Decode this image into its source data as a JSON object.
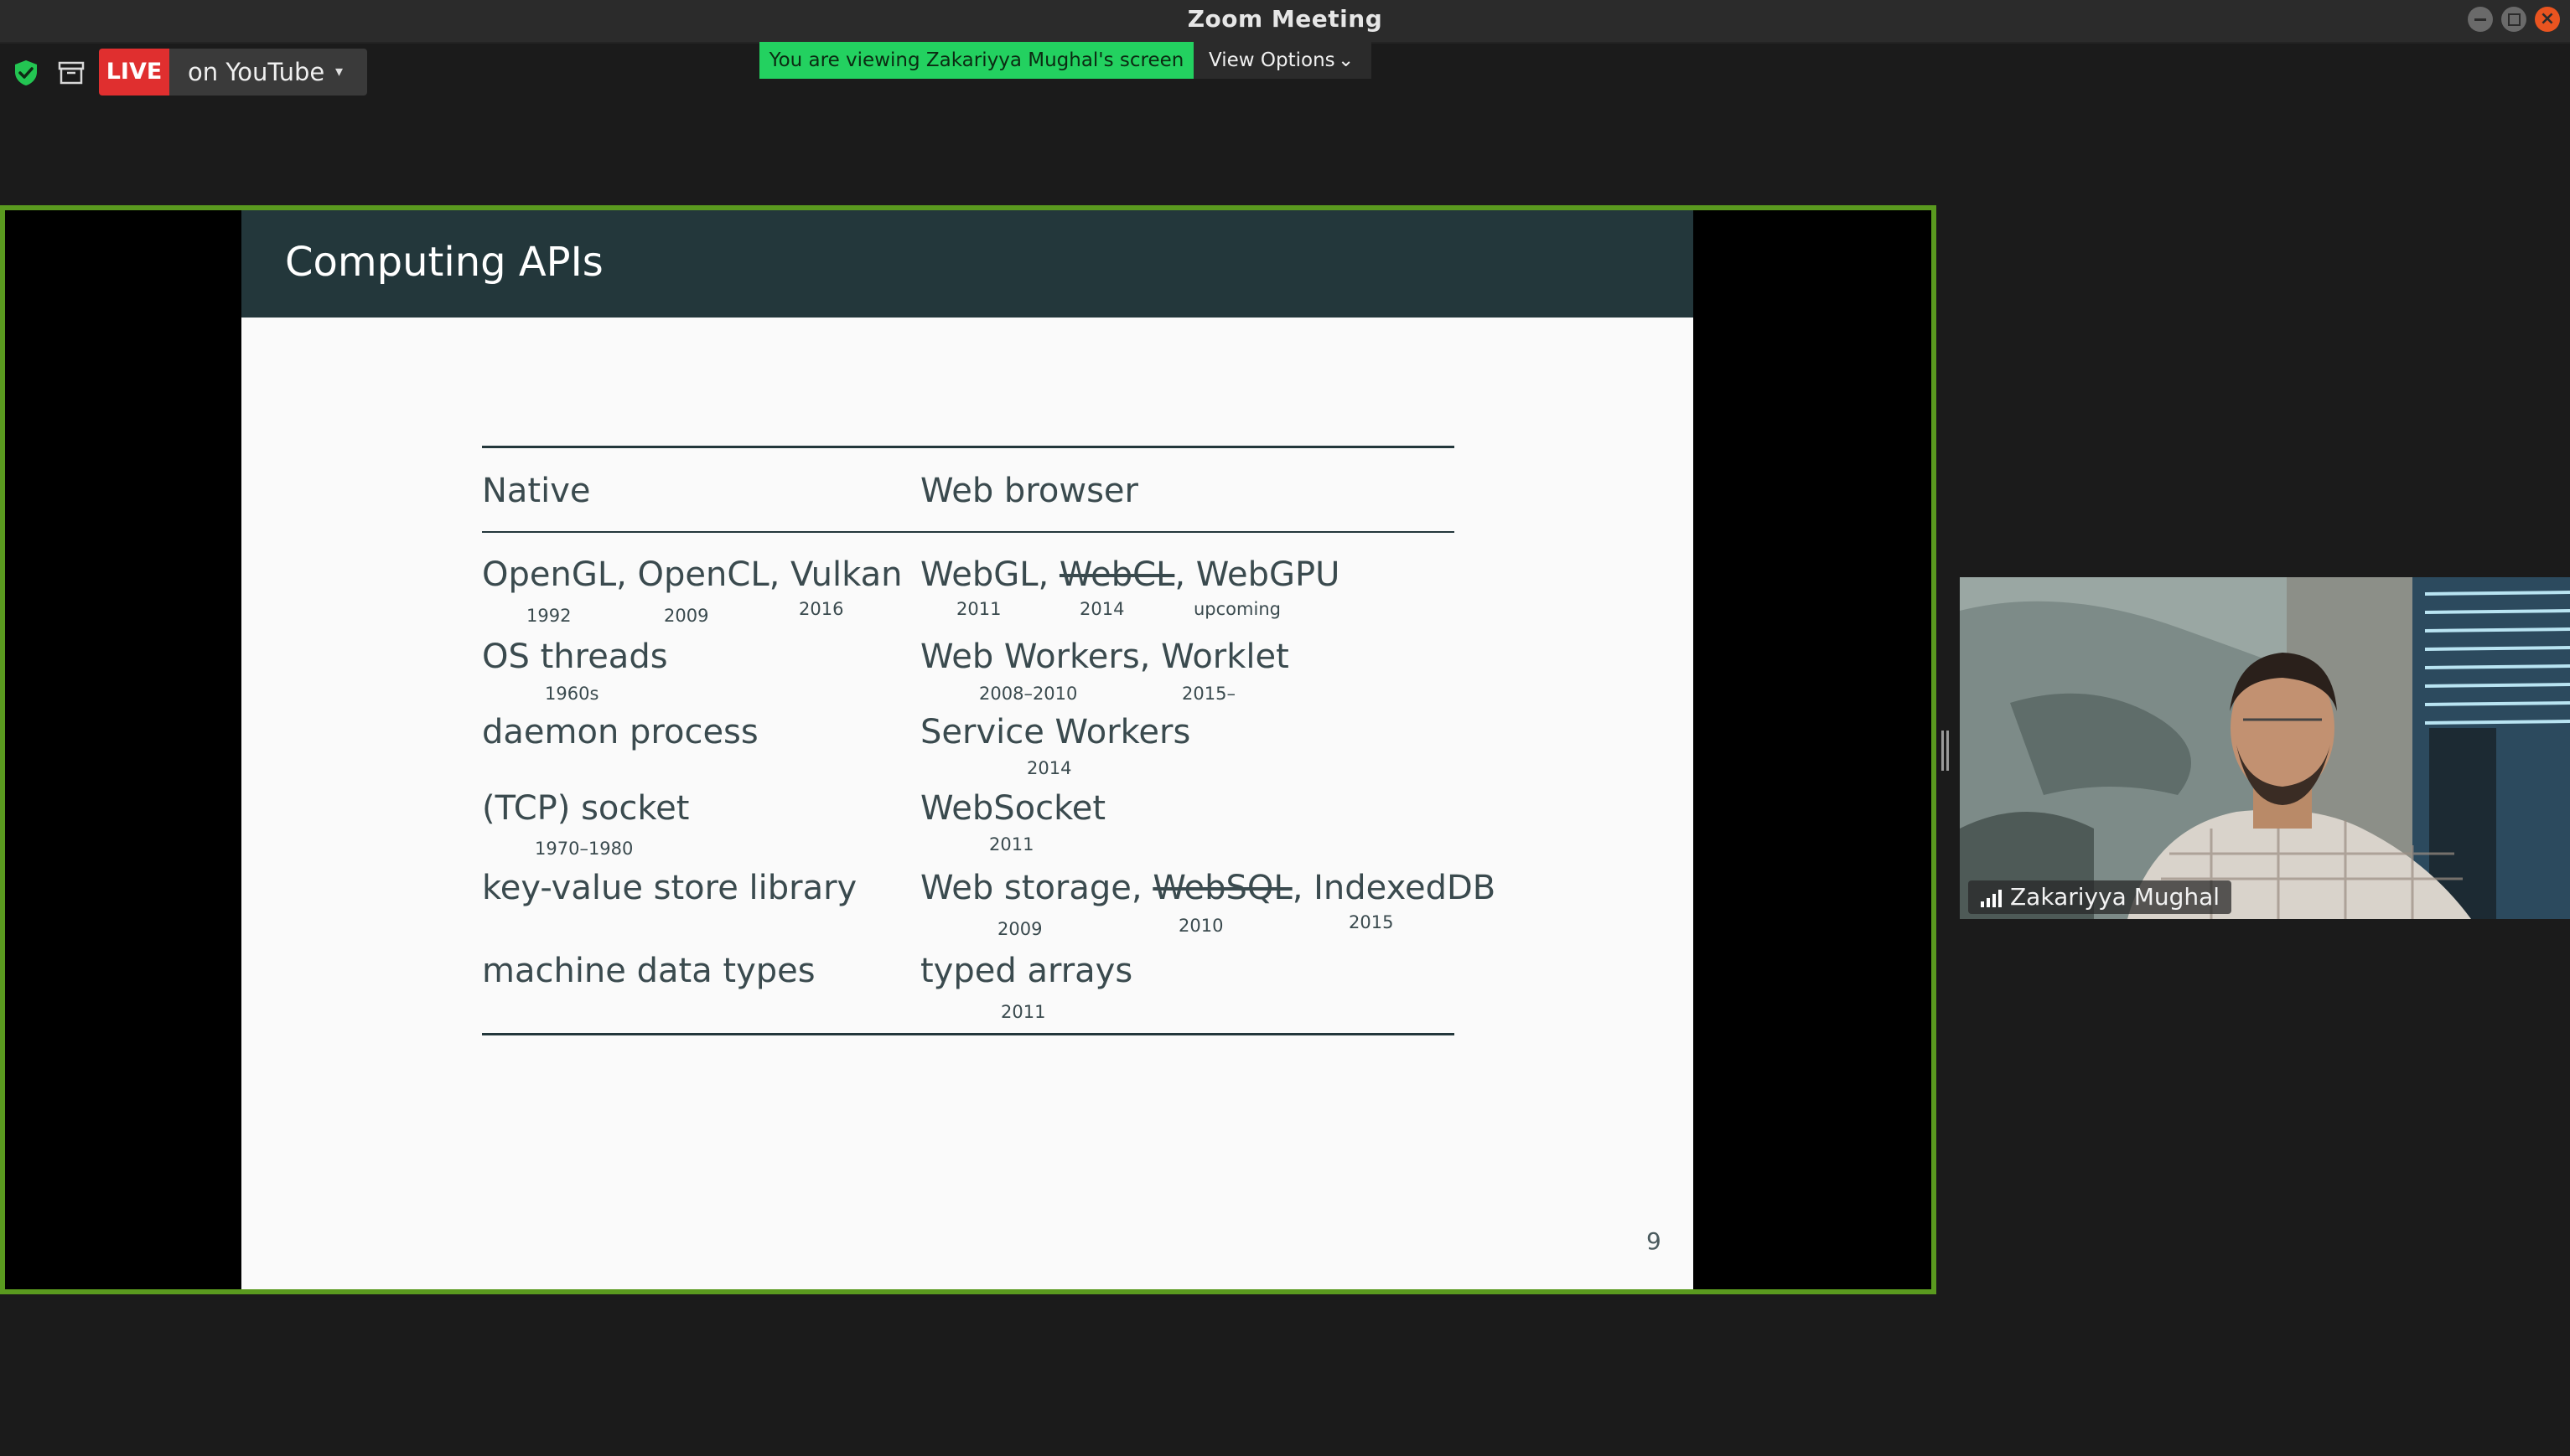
{
  "window": {
    "title": "Zoom Meeting",
    "controls": {
      "minimize": "minimize-icon",
      "maximize": "maximize-icon",
      "close": "close-icon"
    }
  },
  "toolbar": {
    "security_icon": "shield-check-icon",
    "archive_icon": "archive-icon",
    "live_badge": "LIVE",
    "live_destination": "on YouTube",
    "live_caret": "▾"
  },
  "screen_share": {
    "banner": "You are viewing Zakariyya Mughal's screen",
    "view_options": "View Options",
    "view_options_chevron": "⌄"
  },
  "slide": {
    "title": "Computing APIs",
    "page_number": "9",
    "columns": [
      "Native",
      "Web browser"
    ],
    "rows": [
      {
        "native": "OpenGL, OpenCL, Vulkan",
        "native_years": [
          "1992",
          "2009",
          "2016"
        ],
        "web_parts": [
          "WebGL, ",
          "WebCL",
          ", WebGPU"
        ],
        "web_years": [
          "2011",
          "2014",
          "upcoming"
        ]
      },
      {
        "native": "OS threads",
        "native_years": [
          "1960s"
        ],
        "web": "Web Workers, Worklet",
        "web_years": [
          "2008–2010",
          "2015–"
        ]
      },
      {
        "native": "daemon process",
        "web": "Service Workers",
        "web_years": [
          "2014"
        ]
      },
      {
        "native": "(TCP) socket",
        "native_years": [
          "1970–1980"
        ],
        "web": "WebSocket",
        "web_years": [
          "2011"
        ]
      },
      {
        "native": "key-value store library",
        "web_parts": [
          "Web storage, ",
          "WebSQL",
          ", IndexedDB"
        ],
        "web_years": [
          "2009",
          "2010",
          "2015"
        ]
      },
      {
        "native": "machine data types",
        "web": "typed arrays",
        "web_years": [
          "2011"
        ]
      }
    ]
  },
  "participant": {
    "name": "Zakariyya Mughal",
    "signal_icon": "signal-strength-icon"
  },
  "colors": {
    "share_border": "#5a9a1f",
    "banner": "#23d160",
    "live": "#e02f2f",
    "slide_header": "#23373b",
    "close_button": "#e95420"
  }
}
